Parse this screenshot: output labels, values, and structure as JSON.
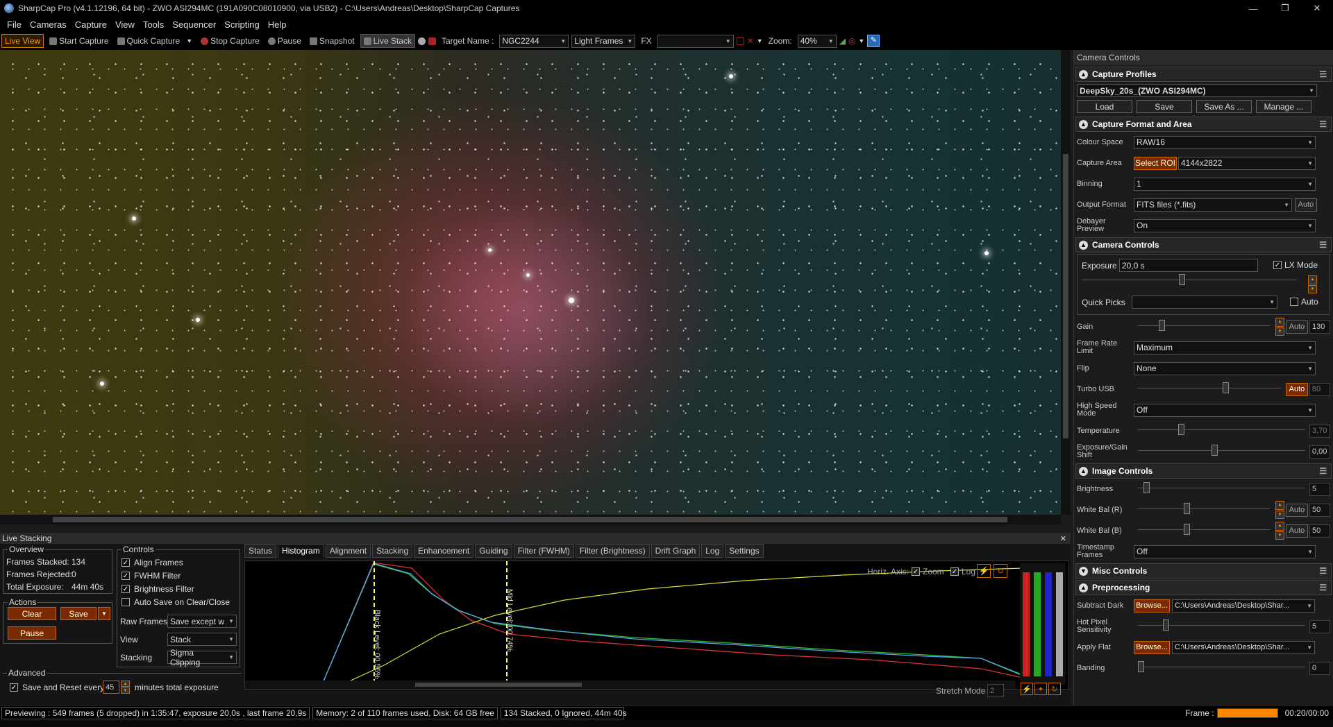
{
  "window": {
    "title": "SharpCap Pro (v4.1.12196, 64 bit) - ZWO ASI294MC (191A090C08010900, via USB2) - C:\\Users\\Andreas\\Desktop\\SharpCap Captures",
    "min": "—",
    "max": "❐",
    "close": "✕"
  },
  "menu": [
    "File",
    "Cameras",
    "Capture",
    "View",
    "Tools",
    "Sequencer",
    "Scripting",
    "Help"
  ],
  "toolbar": {
    "live_view": "Live View",
    "start_capture": "Start Capture",
    "quick_capture": "Quick Capture",
    "stop_capture": "Stop Capture",
    "pause": "Pause",
    "snapshot": "Snapshot",
    "live_stack": "Live Stack",
    "target_label": "Target Name :",
    "target_value": "NGC2244",
    "frame_type": "Light Frames",
    "fx_label": "FX",
    "fx_value": "",
    "zoom_label": "Zoom:",
    "zoom_value": "40%"
  },
  "camera_controls": {
    "panel_title": "Camera Controls",
    "capture_profiles": {
      "title": "Capture Profiles",
      "profile": "DeepSky_20s_(ZWO ASI294MC)",
      "load": "Load",
      "save": "Save",
      "save_as": "Save As ...",
      "manage": "Manage ..."
    },
    "format": {
      "title": "Capture Format and Area",
      "colour_space_label": "Colour Space",
      "colour_space": "RAW16",
      "capture_area_label": "Capture Area",
      "select_roi": "Select ROI",
      "capture_area": "4144x2822",
      "binning_label": "Binning",
      "binning": "1",
      "output_format_label": "Output Format",
      "output_format": "FITS files (*.fits)",
      "auto": "Auto",
      "debayer_label": "Debayer Preview",
      "debayer": "On"
    },
    "camera": {
      "title": "Camera Controls",
      "exposure_label": "Exposure",
      "exposure": "20,0 s",
      "lx_mode": "LX Mode",
      "quick_picks_label": "Quick Picks",
      "quick_picks": "",
      "auto": "Auto",
      "gain_label": "Gain",
      "gain": "130",
      "frame_rate_label": "Frame Rate Limit",
      "frame_rate": "Maximum",
      "flip_label": "Flip",
      "flip": "None",
      "turbo_label": "Turbo USB",
      "turbo": "80",
      "high_speed_label": "High Speed Mode",
      "high_speed": "Off",
      "temperature_label": "Temperature",
      "temperature": "3,70",
      "exp_gain_shift_label": "Exposure/Gain Shift",
      "exp_gain_shift": "0,00"
    },
    "image": {
      "title": "Image Controls",
      "brightness_label": "Brightness",
      "brightness": "5",
      "wb_r_label": "White Bal (R)",
      "wb_r": "50",
      "wb_b_label": "White Bal (B)",
      "wb_b": "50",
      "timestamp_label": "Timestamp Frames",
      "timestamp": "Off"
    },
    "misc": {
      "title": "Misc Controls"
    },
    "preprocessing": {
      "title": "Preprocessing",
      "subtract_dark_label": "Subtract Dark",
      "browse": "Browse...",
      "dark_path": "C:\\Users\\Andreas\\Desktop\\Shar...",
      "hot_pixel_label": "Hot Pixel Sensitivity",
      "hot_pixel": "5",
      "apply_flat_label": "Apply Flat",
      "flat_path": "C:\\Users\\Andreas\\Desktop\\Shar...",
      "banding_label": "Banding",
      "banding": "0"
    }
  },
  "live_stacking": {
    "title": "Live Stacking",
    "overview": {
      "title": "Overview",
      "frames_stacked_label": "Frames Stacked:",
      "frames_stacked": "134",
      "frames_rejected_label": "Frames Rejected:",
      "frames_rejected": "0",
      "total_exposure_label": "Total Exposure:",
      "total_exposure": "44m 40s"
    },
    "actions": {
      "title": "Actions",
      "clear": "Clear",
      "save": "Save",
      "pause": "Pause"
    },
    "advanced": {
      "title": "Advanced",
      "save_reset": "Save and Reset every",
      "minutes": "45",
      "minutes_suffix": "minutes total exposure"
    },
    "controls": {
      "title": "Controls",
      "align": "Align Frames",
      "fwhm": "FWHM Filter",
      "brightness": "Brightness Filter",
      "autosave": "Auto Save on Clear/Close",
      "raw_frames_label": "Raw Frames",
      "raw_frames": "Save except w",
      "view_label": "View",
      "view": "Stack",
      "stacking_label": "Stacking",
      "stacking": "Sigma Clipping"
    },
    "tabs": [
      "Status",
      "Histogram",
      "Alignment",
      "Stacking",
      "Enhancement",
      "Guiding",
      "Filter (FWHM)",
      "Filter (Brightness)",
      "Drift Graph",
      "Log",
      "Settings"
    ],
    "active_tab": "Histogram",
    "histogram": {
      "horiz_axis": "Horiz. Axis:",
      "zoom": "Zoom",
      "log": "Log",
      "black_level": "Black Level: 00,55%",
      "mid_level": "Mid Level: 00,74%",
      "stretch_mode": "Stretch Mode",
      "stretch_value": "2"
    }
  },
  "status": {
    "preview": "Previewing : 549 frames (5 dropped) in 1:35:47, exposure 20,0s , last frame 20,9s",
    "memory": "Memory: 2 of 110 frames used, Disk: 64 GB free",
    "stack": "134 Stacked, 0 Ignored, 44m 40s",
    "frame_label": "Frame :",
    "frame_time": "00:20/00:00",
    "frame_progress": 1.0
  }
}
